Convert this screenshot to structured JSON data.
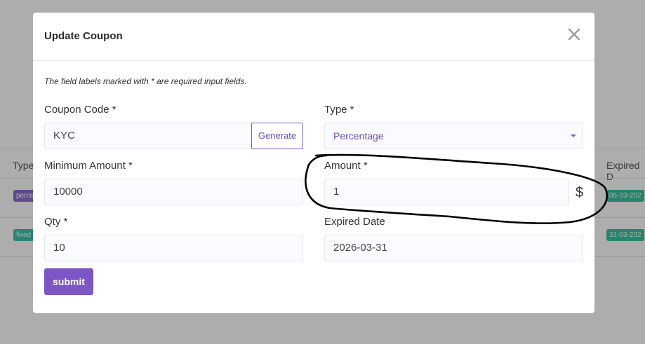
{
  "background": {
    "table_headers": {
      "left": "Type",
      "right": "Expired D"
    },
    "rows": [
      {
        "type_badge": "perce",
        "expired_badge": "05-03-202"
      },
      {
        "type_badge": "fixed",
        "expired_badge": "31-03-202"
      }
    ]
  },
  "modal": {
    "title": "Update Coupon",
    "note": "The field labels marked with * are required input fields.",
    "coupon_code": {
      "label": "Coupon Code *",
      "value": "KYC",
      "generate_label": "Generate"
    },
    "type": {
      "label": "Type *",
      "selected": "Percentage"
    },
    "minimum_amount": {
      "label": "Minimum Amount *",
      "value": "10000"
    },
    "amount": {
      "label": "Amount *",
      "value": "1",
      "suffix": "$"
    },
    "qty": {
      "label": "Qty *",
      "value": "10"
    },
    "expired_date": {
      "label": "Expired Date",
      "value": "2026-03-31"
    },
    "submit_label": "submit"
  },
  "colors": {
    "accent": "#7c55c7",
    "overlay": "rgba(0,0,0,0.32)",
    "annotation_stroke": "#000000"
  },
  "icons": {
    "close": "close-icon",
    "dropdown": "chevron-down-icon"
  }
}
